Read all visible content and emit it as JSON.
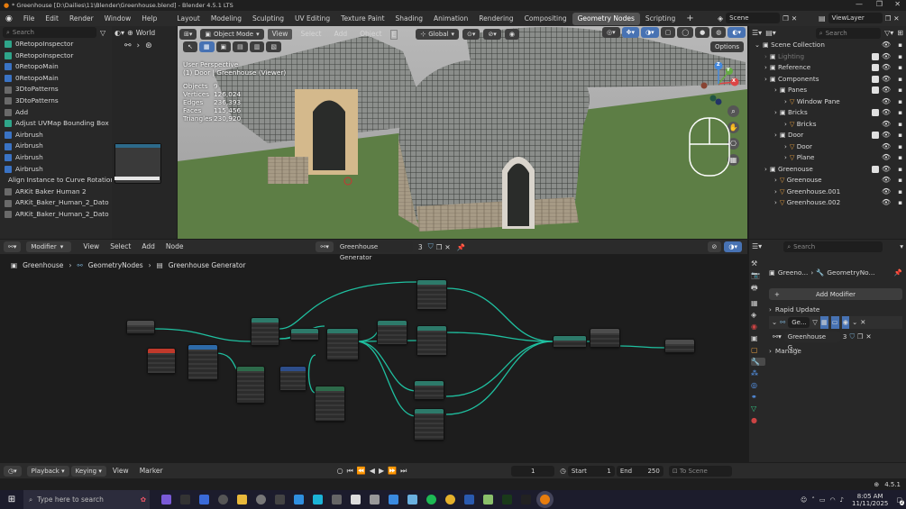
{
  "titlebar": {
    "text": "* Greenhouse [D:\\Dailies\\11\\Blender\\Greenhouse.blend] - Blender 4.5.1 LTS",
    "minimize": "—",
    "maximize": "❐",
    "close": "✕"
  },
  "menu": {
    "items": [
      "File",
      "Edit",
      "Render",
      "Window",
      "Help"
    ],
    "workspaces": [
      "Layout",
      "Modeling",
      "Sculpting",
      "UV Editing",
      "Texture Paint",
      "Shading",
      "Animation",
      "Rendering",
      "Compositing",
      "Geometry Nodes",
      "Scripting"
    ],
    "active_workspace": "Geometry Nodes",
    "add_tab": "+",
    "scene": "Scene",
    "view_layer": "ViewLayer"
  },
  "assets": {
    "search_placeholder": "Search",
    "world_label": "World",
    "items": [
      {
        "label": "0RetopoInspector",
        "color": "#2fa58a"
      },
      {
        "label": "0RetopoInspector",
        "color": "#2fa58a"
      },
      {
        "label": "0RetopoMain",
        "color": "#3a73c4"
      },
      {
        "label": "0RetopoMain",
        "color": "#3a73c4"
      },
      {
        "label": "3DtoPatterns",
        "color": "#6a6a6a"
      },
      {
        "label": "3DtoPatterns",
        "color": "#6a6a6a"
      },
      {
        "label": "Add",
        "color": "#6a6a6a"
      },
      {
        "label": "Adjust UVMap Bounding Box",
        "color": "#2fa58a"
      },
      {
        "label": "Airbrush",
        "color": "#3a73c4"
      },
      {
        "label": "Airbrush",
        "color": "#3a73c4"
      },
      {
        "label": "Airbrush",
        "color": "#3a73c4"
      },
      {
        "label": "Airbrush",
        "color": "#3a73c4"
      },
      {
        "label": "Align Instance to Curve Rotation",
        "color": "#2fa58a"
      },
      {
        "label": "ARKit Baker Human 2",
        "color": "#6a6a6a"
      },
      {
        "label": "ARKit_Baker_Human_2_Dato",
        "color": "#6a6a6a"
      },
      {
        "label": "ARKit_Baker_Human_2_Dato",
        "color": "#6a6a6a"
      }
    ]
  },
  "viewport": {
    "mode": "Object Mode",
    "view": "View",
    "select": "Select",
    "add": "Add",
    "object": "Object",
    "transform": "Global",
    "options": "Options",
    "perspective": "User Perspective",
    "collection_path": "(1) Door | Greenhouse (Viewer)",
    "stats": [
      {
        "label": "Objects",
        "value": "9"
      },
      {
        "label": "Vertices",
        "value": "126,024"
      },
      {
        "label": "Edges",
        "value": "236,393"
      },
      {
        "label": "Faces",
        "value": "115,456"
      },
      {
        "label": "Triangles",
        "value": "230,920"
      }
    ],
    "gizmo": {
      "x": "X",
      "y": "Y",
      "z": "Z"
    }
  },
  "outliner": {
    "search_placeholder": "Search",
    "rows": [
      {
        "label": "Scene Collection",
        "indent": 0,
        "icon": "collection",
        "checkbox": false,
        "dim": false
      },
      {
        "label": "Lighting",
        "indent": 1,
        "icon": "collection",
        "checkbox": true,
        "dim": true
      },
      {
        "label": "Reference",
        "indent": 1,
        "icon": "collection",
        "checkbox": true,
        "dim": false
      },
      {
        "label": "Components",
        "indent": 1,
        "icon": "collection",
        "checkbox": true,
        "dim": false
      },
      {
        "label": "Panes",
        "indent": 2,
        "icon": "collection",
        "checkbox": true,
        "dim": false
      },
      {
        "label": "Window Pane",
        "indent": 3,
        "icon": "mesh",
        "checkbox": false,
        "dim": false
      },
      {
        "label": "Bricks",
        "indent": 2,
        "icon": "collection",
        "checkbox": true,
        "dim": false
      },
      {
        "label": "Bricks",
        "indent": 3,
        "icon": "mesh",
        "checkbox": false,
        "dim": false
      },
      {
        "label": "Door",
        "indent": 2,
        "icon": "collection",
        "checkbox": true,
        "dim": false
      },
      {
        "label": "Door",
        "indent": 3,
        "icon": "mesh",
        "checkbox": false,
        "dim": false
      },
      {
        "label": "Plane",
        "indent": 3,
        "icon": "mesh",
        "checkbox": false,
        "dim": false
      },
      {
        "label": "Greenouse",
        "indent": 1,
        "icon": "collection",
        "checkbox": true,
        "dim": false
      },
      {
        "label": "Greenouse",
        "indent": 2,
        "icon": "mesh",
        "checkbox": false,
        "dim": false
      },
      {
        "label": "Greenhouse.001",
        "indent": 2,
        "icon": "mesh",
        "checkbox": false,
        "dim": false
      },
      {
        "label": "Greenhouse.002",
        "indent": 2,
        "icon": "mesh",
        "checkbox": false,
        "dim": false
      }
    ]
  },
  "node_editor": {
    "editor_type": "Modifier",
    "view": "View",
    "select": "Select",
    "add": "Add",
    "node": "Node",
    "node_group": "Greenhouse Generator",
    "users": "3",
    "breadcrumb": [
      "Greenhouse",
      "GeometryNodes",
      "Greenhouse Generator"
    ]
  },
  "properties": {
    "search_placeholder": "Search",
    "path": [
      "Greeno...",
      "GeometryNo..."
    ],
    "add_modifier": "Add Modifier",
    "panels": [
      {
        "label": "Rapid Update",
        "expanded": false
      },
      {
        "label": "Ge...",
        "expanded": true
      }
    ],
    "node_group": "Greenhouse G...",
    "users": "3",
    "manage": "Manage"
  },
  "timeline": {
    "playback": "Playback",
    "keying": "Keying",
    "view": "View",
    "marker": "Marker",
    "current_frame": "1",
    "start_label": "Start",
    "start": "1",
    "end_label": "End",
    "end": "250",
    "to_scene_range": "To Scene Range"
  },
  "statusbar": {
    "version": "4.5.1"
  },
  "taskbar": {
    "search_placeholder": "Type here to search",
    "time": "8:05 AM",
    "date": "11/11/2025",
    "notification_count": "2"
  }
}
